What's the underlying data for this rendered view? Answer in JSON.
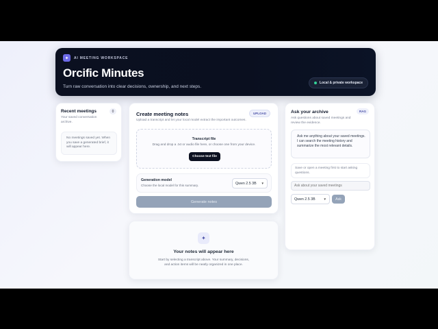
{
  "hero": {
    "eyebrow": "AI MEETING WORKSPACE",
    "title": "Orcific Minutes",
    "subtitle": "Turn raw conversation into clear decisions, ownership, and next steps.",
    "privacy_label": "Local & private workspace"
  },
  "recent": {
    "title": "Recent meetings",
    "count": "0",
    "subtitle": "Your saved conversation archive.",
    "empty_text": "No meetings saved yet. When you save a generated brief, it will appear here."
  },
  "create": {
    "title": "Create meeting notes",
    "subtitle": "Upload a transcript and let your local model extract the important outcomes.",
    "badge": "UPLOAD",
    "dropzone": {
      "title": "Transcript file",
      "hint": "Drag and drop a .txt or audio file here, or choose one from your device.",
      "button_label": "Choose text file"
    },
    "model": {
      "label": "Generation model",
      "hint": "Choose the local model for this summary.",
      "selected": "Qwen 2.5 3B"
    },
    "generate_label": "Generate notes"
  },
  "notes": {
    "icon": "✦",
    "title": "Your notes will appear here",
    "subtitle": "Start by selecting a transcript above. Your summary, decisions, and action items will be neatly organized in one place."
  },
  "archive": {
    "title": "Ask your archive",
    "badge": "RAG",
    "subtitle": "Ask questions about saved meetings and review the evidence.",
    "assistant_message": "Ask me anything about your saved meetings. I can search the meeting history and summarize the most relevant details.",
    "hint": "Save or open a meeting first to start asking questions.",
    "input_placeholder": "Ask about your saved meetings",
    "model_selected": "Qwen 2.5 3B",
    "ask_label": "Ask"
  },
  "colors": {
    "hero_bg": "#0b1020",
    "accent": "#6d6ae8",
    "status_dot": "#34d399",
    "disabled_button": "#94a3b8"
  }
}
